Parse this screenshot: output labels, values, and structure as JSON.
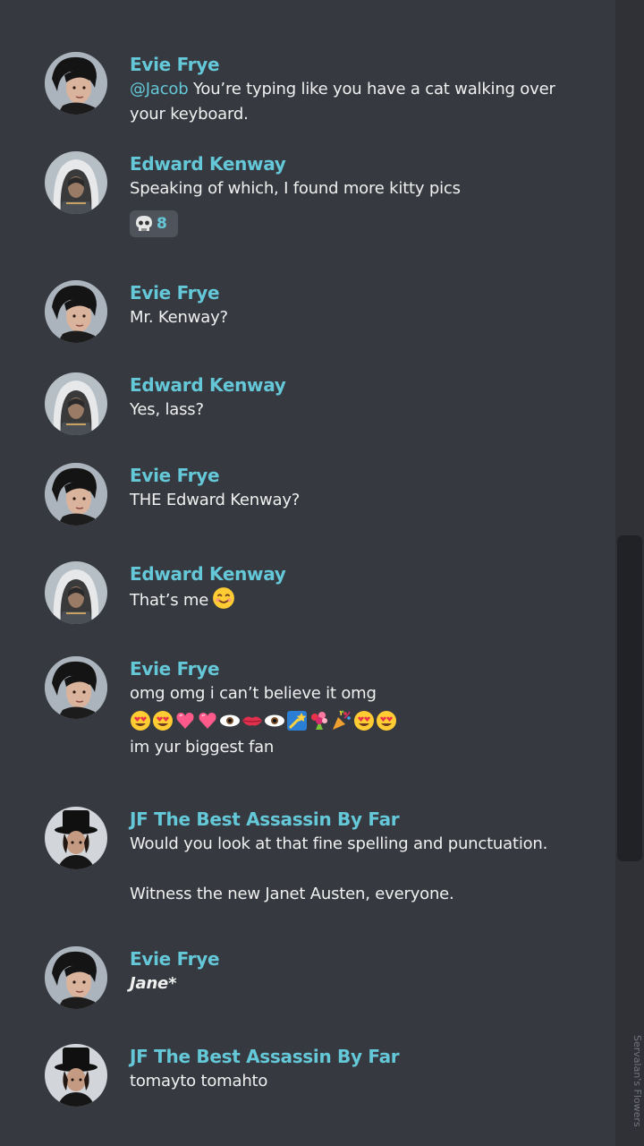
{
  "watermark": "Servalan's Flowers",
  "colors": {
    "background": "#36393f",
    "author": "#64c8d8",
    "text": "#f0f0f0",
    "mention": "#64c8d8",
    "scrollbar_track": "#2f3136",
    "scrollbar_thumb": "#202225"
  },
  "messages": [
    {
      "author": "Evie Frye",
      "avatar": "evie-avatar",
      "mention": "@Jacob",
      "lines": [
        " You’re typing like you have a cat walking over",
        "your keyboard."
      ]
    },
    {
      "author": "Edward Kenway",
      "avatar": "edward-avatar",
      "lines": [
        "Speaking of which, I found more kitty pics"
      ],
      "reaction": {
        "icon": "skull-icon",
        "count": "8"
      }
    },
    {
      "author": "Evie Frye",
      "avatar": "evie-avatar",
      "lines": [
        "Mr. Kenway?"
      ]
    },
    {
      "author": "Edward Kenway",
      "avatar": "edward-avatar",
      "lines": [
        "Yes, lass?"
      ]
    },
    {
      "author": "Evie Frye",
      "avatar": "evie-avatar",
      "lines": [
        "THE Edward Kenway?"
      ]
    },
    {
      "author": "Edward Kenway",
      "avatar": "edward-avatar",
      "lines": [
        "That’s me"
      ],
      "trailing_emoji": "smiling-face-icon"
    },
    {
      "author": "Evie Frye",
      "avatar": "evie-avatar",
      "lines": [
        "omg omg i can’t believe it omg",
        "im yur biggest fan"
      ],
      "emoji_row": [
        "heart-eyes-icon",
        "heart-eyes-icon",
        "pink-heart-icon",
        "pink-heart-icon",
        "eye-icon",
        "lips-icon",
        "eye-icon",
        "shooting-star-icon",
        "bouquet-icon",
        "party-popper-icon",
        "heart-eyes-icon",
        "heart-eyes-icon"
      ]
    },
    {
      "author": "JF The Best Assassin By Far",
      "avatar": "jf-avatar",
      "lines": [
        "Would you look at that fine spelling and punctuation.",
        "Witness the new Janet Austen, everyone."
      ]
    },
    {
      "author": "Evie Frye",
      "avatar": "evie-avatar",
      "lines": [
        "Jane*"
      ]
    },
    {
      "author": "JF The Best Assassin By Far",
      "avatar": "jf-avatar",
      "lines": [
        "tomayto tomahto"
      ]
    }
  ]
}
